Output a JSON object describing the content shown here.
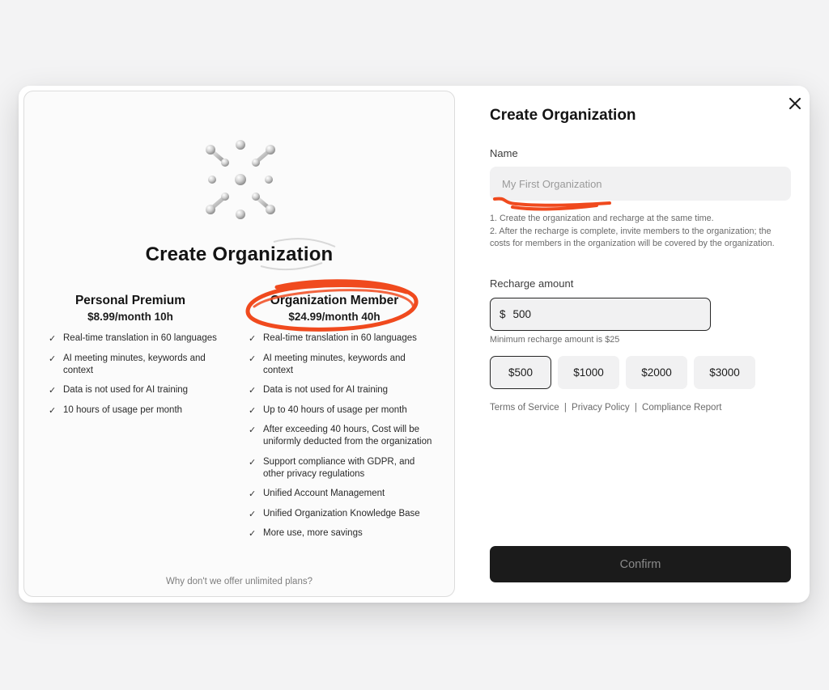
{
  "left": {
    "title": "Create Organization",
    "plans": [
      {
        "name": "Personal Premium",
        "price": "$8.99/month 10h",
        "features": [
          "Real-time translation in 60 languages",
          "AI meeting minutes, keywords and context",
          "Data is not used for AI training",
          "10 hours of usage per month"
        ]
      },
      {
        "name": "Organization Member",
        "price": "$24.99/month 40h",
        "features": [
          "Real-time translation in 60 languages",
          "AI meeting minutes, keywords and context",
          "Data is not used for AI training",
          "Up to 40 hours of usage per month",
          "After exceeding 40 hours, Cost will be uniformly deducted from the organization",
          "Support compliance with GDPR, and other privacy regulations",
          "Unified Account Management",
          "Unified Organization Knowledge Base",
          "More use, more savings"
        ]
      }
    ],
    "footer_link": "Why don't we offer unlimited plans?"
  },
  "right": {
    "title": "Create Organization",
    "name_label": "Name",
    "name_placeholder": "My First Organization",
    "notes": [
      "1. Create the organization and recharge at the same time.",
      "2. After the recharge is complete, invite members to the organization; the costs for members in the organization will be covered by the organization."
    ],
    "recharge_label": "Recharge amount",
    "currency_symbol": "$",
    "recharge_value": "500",
    "min_note": "Minimum recharge amount is $25",
    "amount_options": [
      "$500",
      "$1000",
      "$2000",
      "$3000"
    ],
    "selected_amount": "$500",
    "links": [
      "Terms of Service",
      "Privacy Policy",
      "Compliance Report"
    ],
    "link_separator": "|",
    "confirm_label": "Confirm"
  },
  "icons": {
    "close": "close-icon",
    "logo": "molecule-logo-icon",
    "check": "check-icon"
  },
  "colors": {
    "annotation_red": "#f04a1e",
    "confirm_bg": "#1b1b1b",
    "page_bg": "#f3f3f4"
  }
}
